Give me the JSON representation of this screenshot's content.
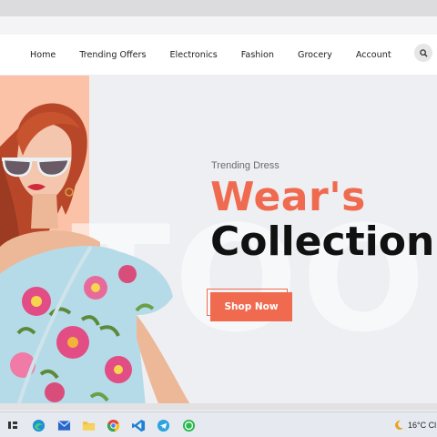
{
  "nav": {
    "items": [
      {
        "label": "Home"
      },
      {
        "label": "Trending Offers"
      },
      {
        "label": "Electronics"
      },
      {
        "label": "Fashion"
      },
      {
        "label": "Grocery"
      },
      {
        "label": "Account"
      }
    ],
    "search_icon": "search-icon"
  },
  "hero": {
    "subtitle": "Trending Dress",
    "title_line1": "Wear's",
    "title_line2": "Collection",
    "cta_label": "Shop Now",
    "background_word": "TOOL",
    "colors": {
      "accent": "#f06a50",
      "peach": "#fcc2a8",
      "background": "#eeeff2"
    }
  },
  "taskbar": {
    "icons": [
      "task-view-icon",
      "edge-icon",
      "mail-icon",
      "file-explorer-icon",
      "chrome-icon",
      "vscode-icon",
      "telegram-icon",
      "whatsapp-icon"
    ],
    "weather_text": "16°C Cl"
  }
}
